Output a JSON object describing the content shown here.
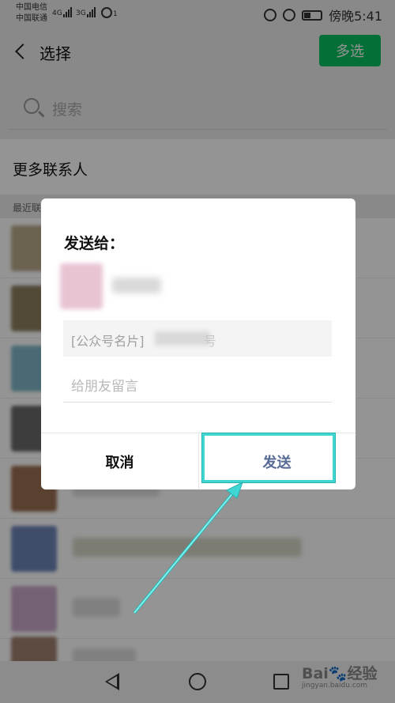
{
  "status_bar": {
    "carrier_1": "中国电信",
    "carrier_2": "中国联通",
    "net_1": "4G",
    "net_2": "3G",
    "hotspot_label": "1",
    "time": "傍晚5:41"
  },
  "header": {
    "title": "选择",
    "multi_select_label": "多选"
  },
  "search": {
    "placeholder": "搜索"
  },
  "more_contacts_label": "更多联系人",
  "section_label": "最近联系人",
  "dialog": {
    "title": "发送给：",
    "card_prefix": "[公众号名片]",
    "card_suffix": "号",
    "message_placeholder": "给朋友留言",
    "cancel_label": "取消",
    "send_label": "发送"
  },
  "watermark": {
    "brand_1": "Bai",
    "brand_paw": "🐾",
    "brand_2": "经验",
    "url": "jingyan.baidu.com"
  },
  "colors": {
    "accent_green": "#07c160",
    "send_blue": "#576b95",
    "highlight_cyan": "#3fd6d3"
  }
}
